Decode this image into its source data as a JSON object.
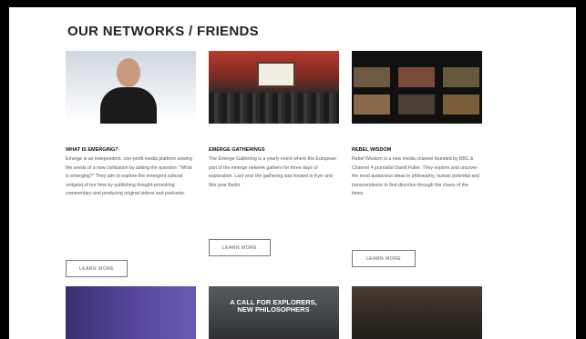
{
  "section": {
    "title": "OUR NETWORKS / FRIENDS"
  },
  "cards": [
    {
      "heading": "WHAT IS EMERGING?",
      "text": "Emerge is an independent, non-profit media platform sowing the seeds of a new civilisation by asking the question: “What is emerging?” They aim to explore the emergent cultural zeitgeist of our time by publishing thought-provoking commentary and producing original videos and podcasts.",
      "button": "LEARN MORE"
    },
    {
      "heading": "EMERGE GATHERINGS",
      "text": "The Emerge Gathering is a yearly event where the European part of the emerge network gathers for three days of exploration. Last year the gathering was hosted in Kyiv and this year Berlin.",
      "button": "LEARN MORE"
    },
    {
      "heading": "REBEL WISDOM",
      "text": "Rebel Wisdom is a new media channel founded by BBC & Channel 4 journalist David Fuller. They explore and uncover the most audacious ideas in philosophy, human potential and transcendence to find direction through the chaos of the times.",
      "button": "LEARN MORE"
    }
  ],
  "bottom_tiles": [
    {
      "text": ""
    },
    {
      "text": "A CALL FOR EXPLORERS, NEW PHILOSOPHERS"
    },
    {
      "text": ""
    }
  ],
  "colors": {
    "background": "#ffffff",
    "outer": "#000000",
    "title": "#222222",
    "body_text": "#555555",
    "button_border": "#777777"
  }
}
